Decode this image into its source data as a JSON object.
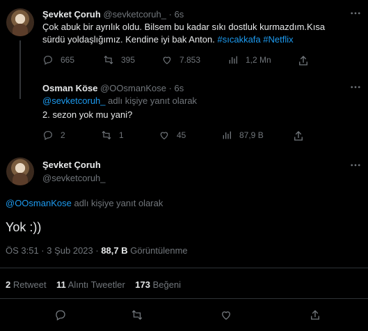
{
  "tweet1": {
    "name": "Şevket Çoruh",
    "handle": "@sevketcoruh_",
    "sep": "·",
    "time": "6s",
    "text_line1": "Çok abuk bir ayrılık oldu. Bilsem bu kadar sıkı dostluk kurmazdım.Kısa",
    "text_line2": "sürdü yoldaşlığımız. Kendine iyi bak Anton.",
    "hashtag1": "#sıcakkafa",
    "hashtag2": "#Netflix",
    "replies": "665",
    "retweets": "395",
    "likes": "7.853",
    "views": "1,2 Mn"
  },
  "reply1": {
    "name": "Osman Köse",
    "handle": "@OOsmanKose",
    "sep": "·",
    "time": "6s",
    "reply_to": "@sevketcoruh_",
    "reply_suffix": "adlı kişiye yanıt olarak",
    "text": "2. sezon yok mu yani?",
    "replies": "2",
    "retweets": "1",
    "likes": "45",
    "views": "87,9 B"
  },
  "main": {
    "name": "Şevket Çoruh",
    "handle": "@sevketcoruh_",
    "reply_to": "@OOsmanKose",
    "reply_suffix": "adlı kişiye yanıt olarak",
    "text": "Yok :))",
    "timestamp": "ÖS 3:51 · 3 Şub 2023 ·",
    "views_count": "88,7 B",
    "views_label": "Görüntülenme",
    "retweet_count": "2",
    "retweet_label": "Retweet",
    "quote_count": "11",
    "quote_label": "Alıntı Tweetler",
    "like_count": "173",
    "like_label": "Beğeni"
  },
  "colors": {
    "accent": "#1d9bf0",
    "muted": "#71767b",
    "divider": "#2f3336"
  },
  "icons": [
    "more-icon",
    "reply-icon",
    "retweet-icon",
    "like-icon",
    "views-icon",
    "share-icon"
  ]
}
